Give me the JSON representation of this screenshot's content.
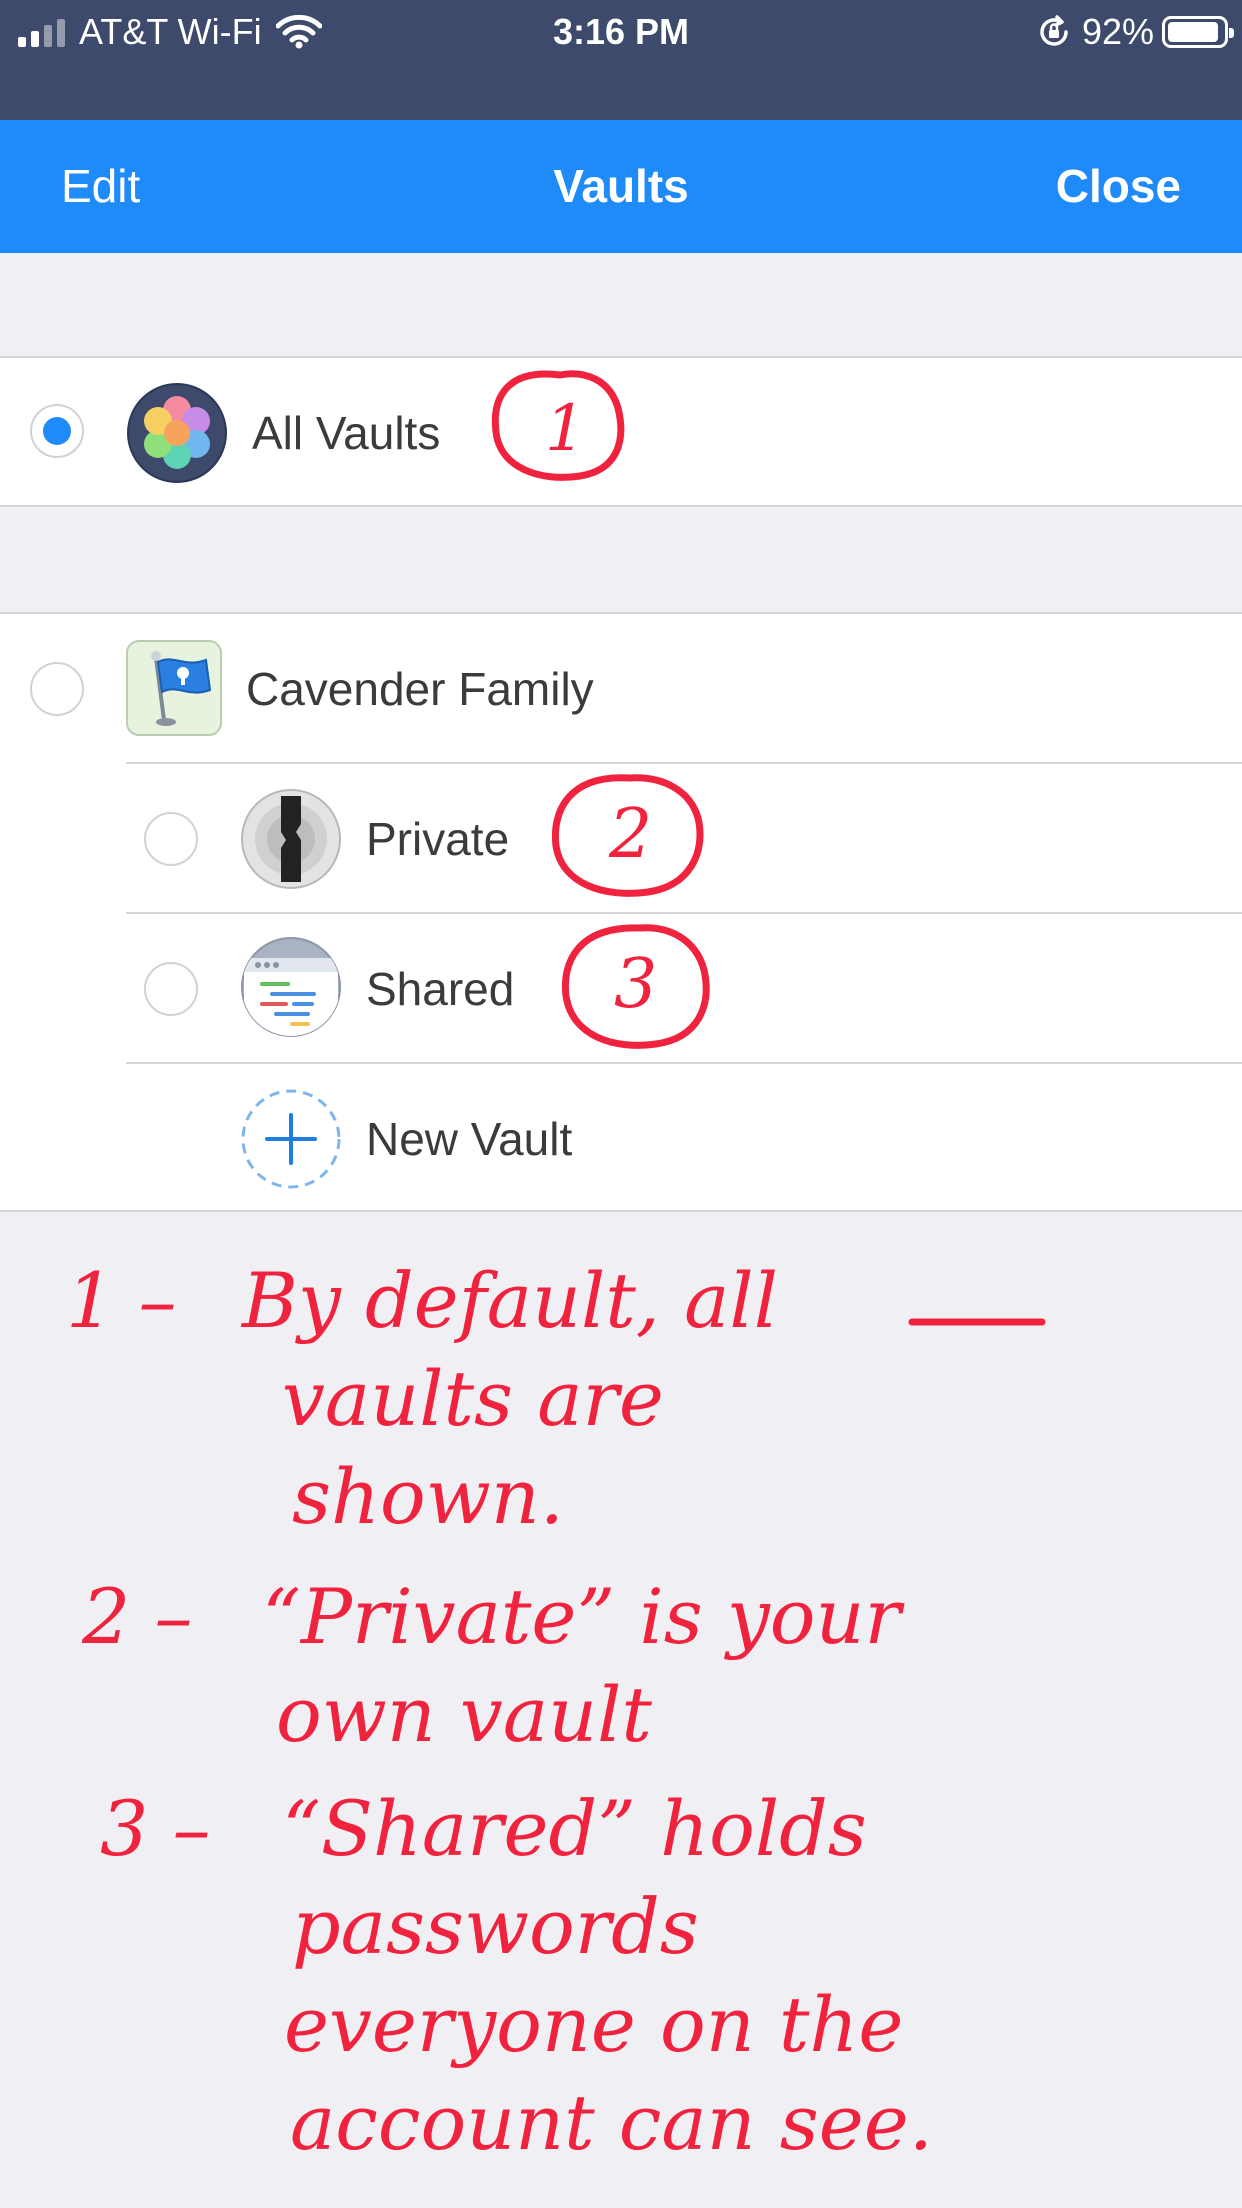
{
  "status_bar": {
    "carrier": "AT&T Wi-Fi",
    "time": "3:16 PM",
    "battery": "92%",
    "battery_level": 0.92,
    "icons": [
      "signal-icon",
      "wifi-icon",
      "rotation-lock-icon",
      "battery-icon"
    ]
  },
  "nav": {
    "edit_label": "Edit",
    "title": "Vaults",
    "close_label": "Close"
  },
  "vaults": {
    "all": {
      "label": "All Vaults",
      "selected": true
    },
    "account": {
      "label": "Cavender Family",
      "selected": false
    },
    "children": [
      {
        "label": "Private",
        "selected": false
      },
      {
        "label": "Shared",
        "selected": false
      }
    ],
    "new_vault_label": "New Vault"
  },
  "annotations": {
    "markers": [
      "1",
      "2",
      "3"
    ],
    "notes": [
      {
        "number": "1 –",
        "lines": [
          "By default, all",
          "vaults are",
          "shown."
        ]
      },
      {
        "number": "2 –",
        "lines": [
          "“Private” is your",
          "own vault"
        ]
      },
      {
        "number": "3 –",
        "lines": [
          "“Shared” holds",
          "passwords",
          "everyone on the",
          "account can see."
        ]
      }
    ]
  },
  "colors": {
    "status_bar": "#3e4a6b",
    "nav_bar": "#1f8bf8",
    "accent": "#1f8bf8",
    "annotation": "#f0233f",
    "background": "#efeff4"
  }
}
